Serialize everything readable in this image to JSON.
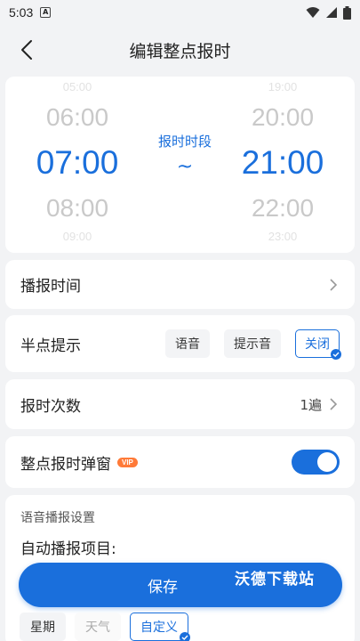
{
  "status_bar": {
    "time": "5:03",
    "notif_glyph": "A"
  },
  "nav": {
    "title": "编辑整点报时"
  },
  "picker": {
    "label": "报时时段",
    "separator": "~",
    "start": {
      "far_above": "05:00",
      "above": "06:00",
      "selected": "07:00",
      "below": "08:00",
      "far_below": "09:00"
    },
    "end": {
      "far_above": "19:00",
      "above": "20:00",
      "selected": "21:00",
      "below": "22:00",
      "far_below": "23:00"
    }
  },
  "broadcast_time": {
    "label": "播报时间"
  },
  "half_hour": {
    "label": "半点提示",
    "options": [
      "语音",
      "提示音",
      "关闭"
    ],
    "selected": "关闭"
  },
  "repeat": {
    "label": "报时次数",
    "value": "1遍"
  },
  "popup": {
    "label": "整点报时弹窗",
    "badge": "VIP",
    "enabled": true
  },
  "voice": {
    "section_title": "语音播报设置",
    "auto_items_label": "自动播报项目:",
    "tags": [
      "星期",
      "天气",
      "自定义"
    ],
    "selected_tag": "自定义"
  },
  "save_button": {
    "label": "保存"
  },
  "watermark": "沃德下载站",
  "colors": {
    "accent": "#1a6fdc",
    "vip": "#ff7a38",
    "background": "#f2f3f5"
  }
}
